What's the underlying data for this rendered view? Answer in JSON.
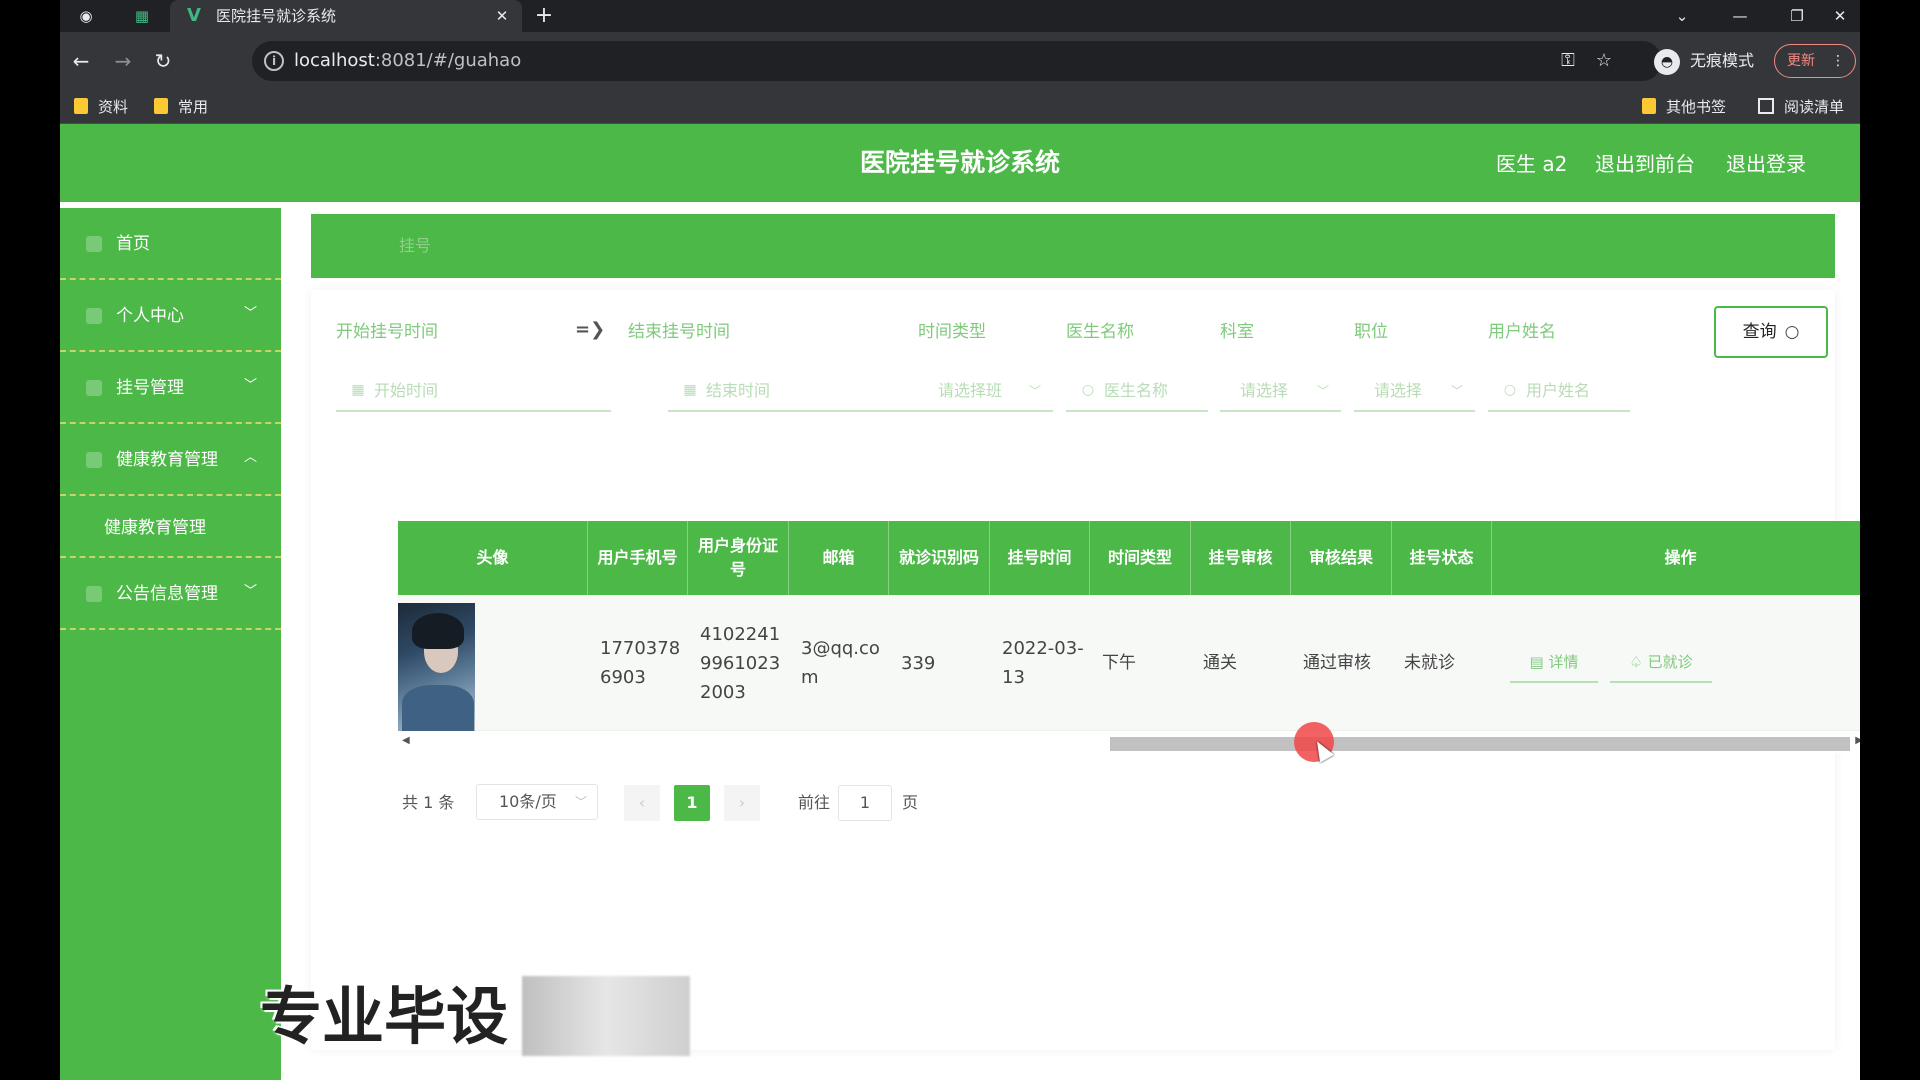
{
  "browser": {
    "tab_title": "医院挂号就诊系统",
    "tab_close": "✕",
    "new_tab": "+",
    "url_host": "localhost",
    "url_rest": ":8081/#/guahao",
    "incognito_label": "无痕模式",
    "update_label": "更新",
    "bookmarks": [
      "资料",
      "常用"
    ],
    "bookmarks_right": [
      "其他书签",
      "阅读清单"
    ]
  },
  "header": {
    "title": "医院挂号就诊系统",
    "user": "医生 a2",
    "to_front": "退出到前台",
    "logout": "退出登录"
  },
  "sidebar": {
    "items": [
      {
        "label": "首页"
      },
      {
        "label": "个人中心",
        "arrow": "﹀"
      },
      {
        "label": "挂号管理",
        "arrow": "﹀"
      },
      {
        "label": "健康教育管理",
        "arrow": "︿"
      },
      {
        "label": "健康教育管理"
      },
      {
        "label": "公告信息管理",
        "arrow": "﹀"
      }
    ]
  },
  "breadcrumb": "挂号",
  "search": {
    "labels": {
      "start_time": "开始挂号时间",
      "sep": "=❯",
      "end_time": "结束挂号时间",
      "time_type": "时间类型",
      "doctor_name": "医生名称",
      "department": "科室",
      "position": "职位",
      "user_name": "用户姓名"
    },
    "placeholders": {
      "start_time": "开始时间",
      "end_time": "结束时间",
      "time_type": "请选择班",
      "doctor_name": "医生名称",
      "department": "请选择",
      "position": "请选择",
      "user_name": "用户姓名"
    },
    "query_button": "查询"
  },
  "table": {
    "headers": {
      "avatar": "头像",
      "phone": "用户手机号",
      "idcard": "用户身份证号",
      "email": "邮箱",
      "visit_code": "就诊识别码",
      "reg_time": "挂号时间",
      "time_type": "时间类型",
      "audit": "挂号审核",
      "audit_result": "审核结果",
      "status": "挂号状态",
      "actions": "操作"
    },
    "rows": [
      {
        "phone": "17703786903",
        "idcard": "410224199610232003",
        "email": "3@qq.com",
        "visit_code": "339",
        "reg_time": "2022-03-13",
        "time_type": "下午",
        "audit": "通关",
        "audit_result": "通过审核",
        "status": "未就诊",
        "detail_label": "详情",
        "visited_label": "已就诊"
      }
    ]
  },
  "pagination": {
    "total": "共 1 条",
    "page_size": "10条/页",
    "current_page": "1",
    "goto_prefix": "前往",
    "goto_value": "1",
    "goto_suffix": "页"
  },
  "watermark": "专业毕设"
}
